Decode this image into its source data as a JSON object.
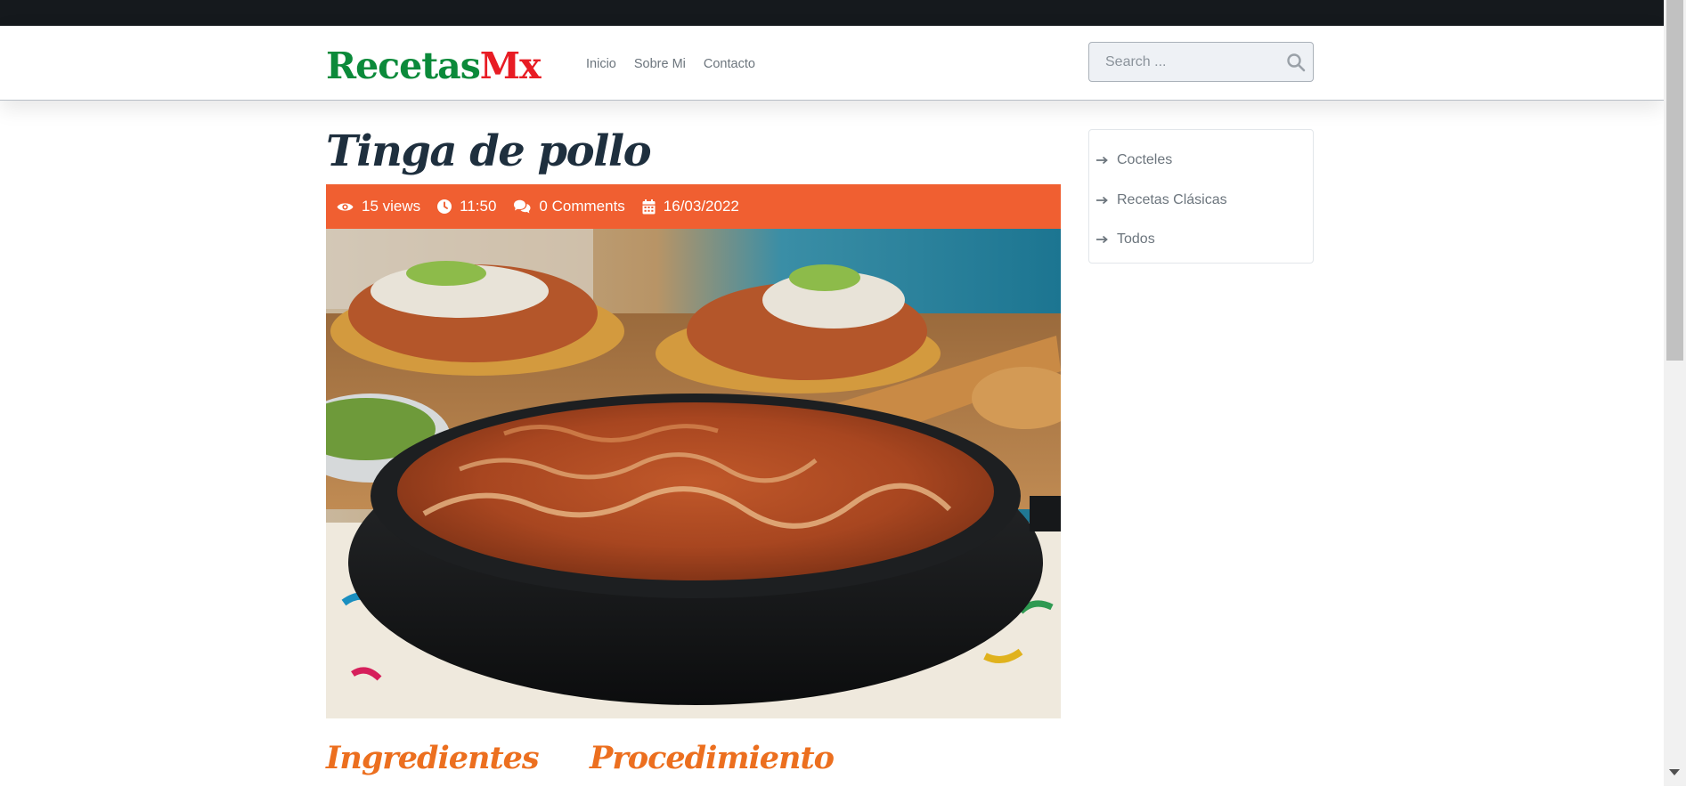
{
  "brand": {
    "part1": "Recetas",
    "part2": "Mx",
    "color1": "#0b8a3a",
    "color2": "#e81c24"
  },
  "nav": {
    "items": [
      {
        "label": "Inicio"
      },
      {
        "label": "Sobre Mi"
      },
      {
        "label": "Contacto"
      }
    ]
  },
  "search": {
    "placeholder": "Search ...",
    "value": "",
    "icon": "search-icon"
  },
  "post": {
    "title": "Tinga de pollo",
    "meta": {
      "views": "15 views",
      "time": "11:50",
      "comments": "0 Comments",
      "date": "16/03/2022"
    },
    "meta_bar_color": "#f05f31",
    "sections": [
      {
        "heading": "Ingredientes"
      },
      {
        "heading": "Procedimiento"
      }
    ]
  },
  "sidebar": {
    "items": [
      {
        "label": "Cocteles"
      },
      {
        "label": "Recetas Clásicas"
      },
      {
        "label": "Todos"
      }
    ],
    "icon": "arrow-right-icon"
  },
  "colors": {
    "topbar": "#15191d",
    "heading": "#1e2f3e",
    "section_heading": "#ec6f1f"
  }
}
